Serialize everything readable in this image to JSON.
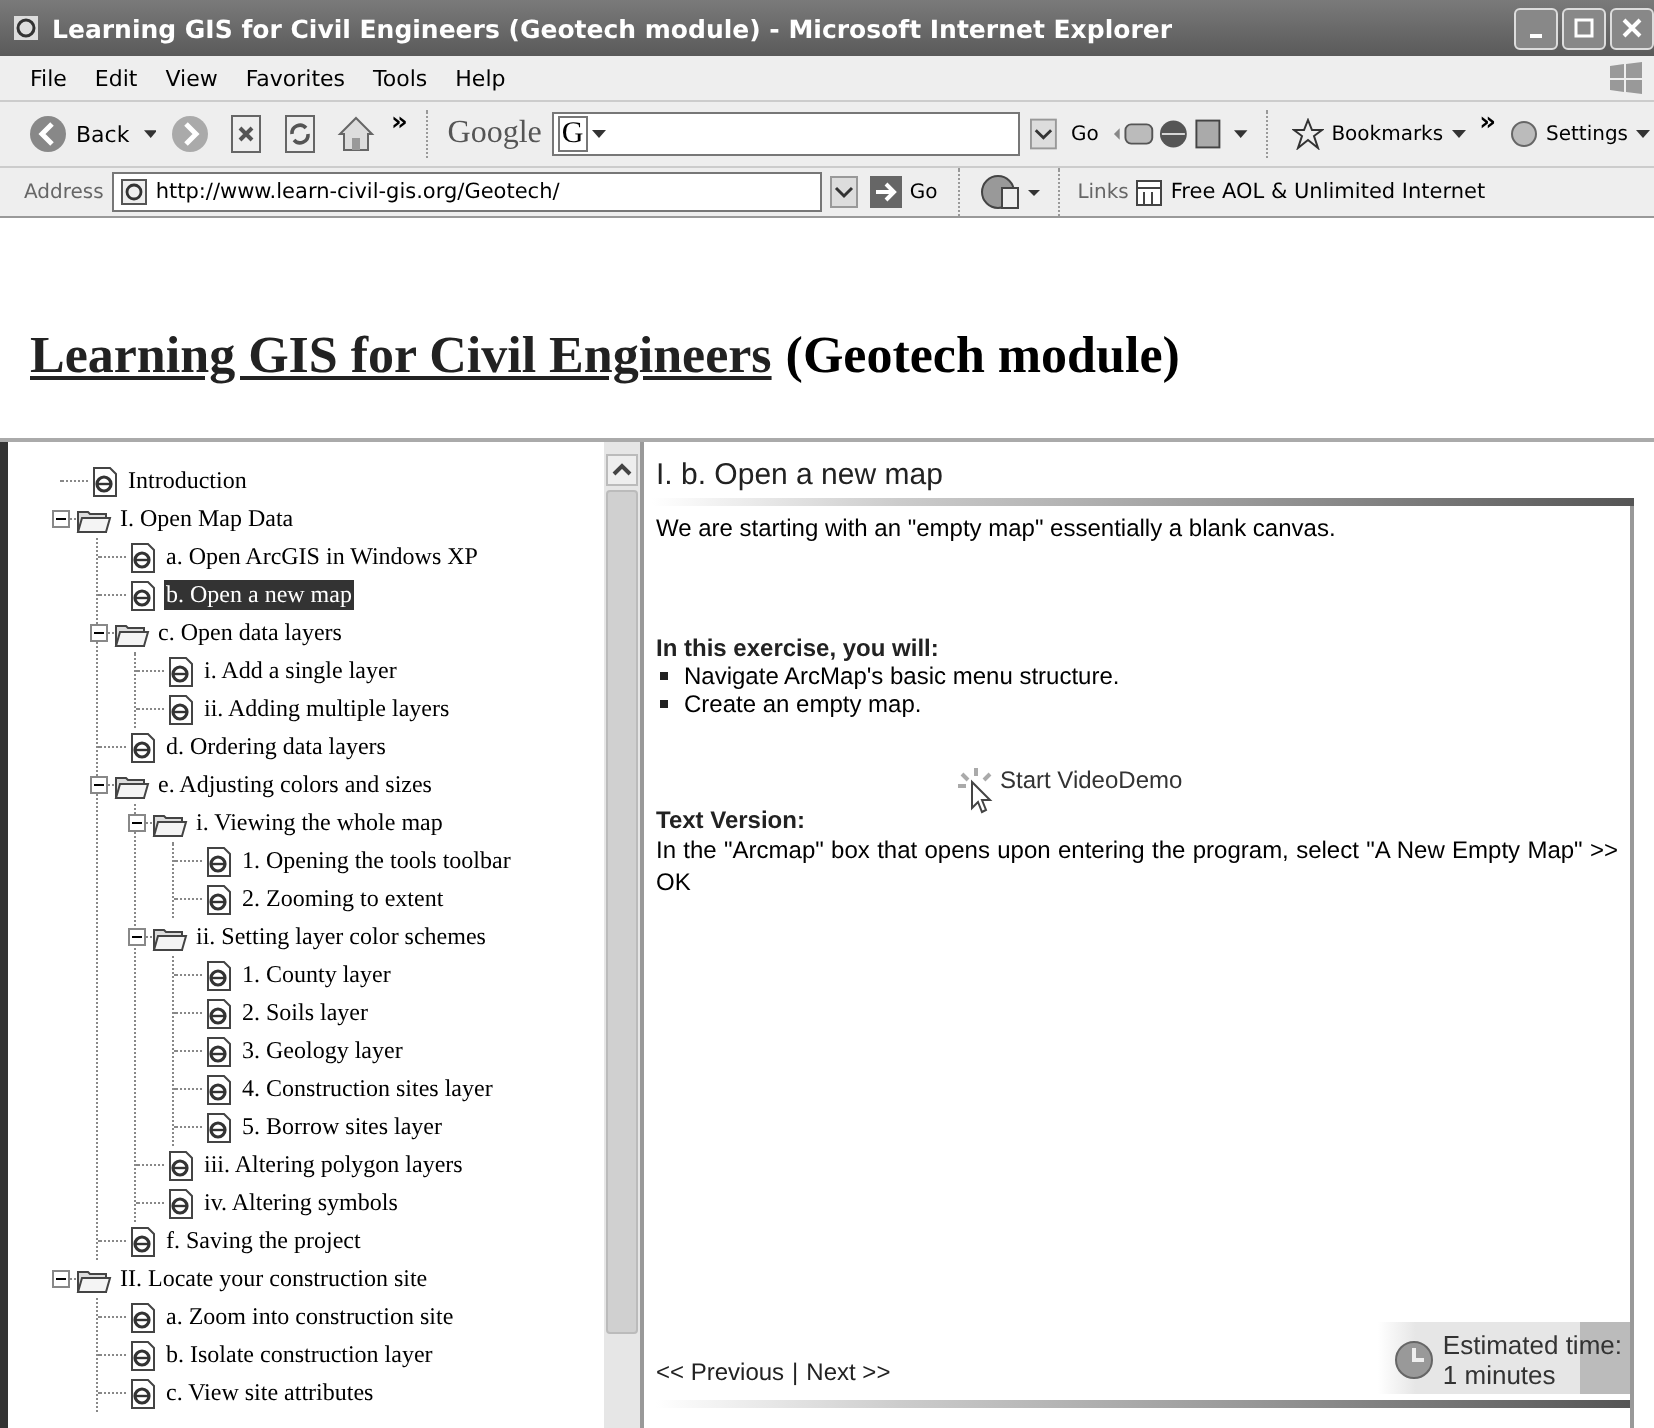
{
  "window": {
    "title": "Learning GIS for Civil Engineers (Geotech module) - Microsoft Internet Explorer"
  },
  "menu": [
    "File",
    "Edit",
    "View",
    "Favorites",
    "Tools",
    "Help"
  ],
  "toolbar": {
    "back": "Back",
    "chevron": "»",
    "search_logo": "Google",
    "search_button": "G",
    "go": "Go",
    "bookmarks": "Bookmarks",
    "chevron_2": "»",
    "settings": "Settings"
  },
  "address_bar": {
    "label": "Address",
    "url": "http://www.learn-civil-gis.org/Geotech/",
    "go": "Go",
    "links_label": "Links",
    "link": "Free AOL & Unlimited Internet"
  },
  "page": {
    "title_link": "Learning GIS for Civil Engineers",
    "title_rest": "(Geotech module)"
  },
  "tree": [
    {
      "label": "Introduction",
      "kind": "page",
      "selected": false
    },
    {
      "label": "I. Open Map Data",
      "kind": "folder",
      "expanded": true,
      "selected": false,
      "children": [
        {
          "label": "a. Open ArcGIS in Windows XP",
          "kind": "page",
          "selected": false
        },
        {
          "label": "b. Open a new map",
          "kind": "page",
          "selected": true
        },
        {
          "label": "c. Open data layers",
          "kind": "folder",
          "expanded": true,
          "selected": false,
          "children": [
            {
              "label": "i. Add a single layer",
              "kind": "page",
              "selected": false
            },
            {
              "label": "ii. Adding multiple layers",
              "kind": "page",
              "selected": false
            }
          ]
        },
        {
          "label": "d. Ordering data layers",
          "kind": "page",
          "selected": false
        },
        {
          "label": "e. Adjusting colors and sizes",
          "kind": "folder",
          "expanded": true,
          "selected": false,
          "children": [
            {
              "label": "i. Viewing the whole map",
              "kind": "folder",
              "expanded": true,
              "selected": false,
              "children": [
                {
                  "label": "1. Opening the tools toolbar",
                  "kind": "page",
                  "selected": false
                },
                {
                  "label": "2. Zooming to extent",
                  "kind": "page",
                  "selected": false
                }
              ]
            },
            {
              "label": "ii. Setting layer color schemes",
              "kind": "folder",
              "expanded": true,
              "selected": false,
              "children": [
                {
                  "label": "1. County layer",
                  "kind": "page",
                  "selected": false
                },
                {
                  "label": "2. Soils layer",
                  "kind": "page",
                  "selected": false
                },
                {
                  "label": "3. Geology layer",
                  "kind": "page",
                  "selected": false
                },
                {
                  "label": "4. Construction sites layer",
                  "kind": "page",
                  "selected": false
                },
                {
                  "label": "5. Borrow sites layer",
                  "kind": "page",
                  "selected": false
                }
              ]
            },
            {
              "label": "iii. Altering polygon layers",
              "kind": "page",
              "selected": false
            },
            {
              "label": "iv. Altering symbols",
              "kind": "page",
              "selected": false
            }
          ]
        },
        {
          "label": "f. Saving the project",
          "kind": "page",
          "selected": false
        }
      ]
    },
    {
      "label": "II. Locate your construction site",
      "kind": "folder",
      "expanded": true,
      "selected": false,
      "children": [
        {
          "label": "a. Zoom into construction site",
          "kind": "page",
          "selected": false
        },
        {
          "label": "b. Isolate construction layer",
          "kind": "page",
          "selected": false
        },
        {
          "label": "c. View site attributes",
          "kind": "page",
          "selected": false
        }
      ]
    }
  ],
  "lesson": {
    "heading": "I. b. Open a new map",
    "intro": "We are starting with an \"empty map\" essentially a blank canvas.",
    "objectives_title": "In this exercise, you will:",
    "objectives": [
      "Navigate ArcMap's basic menu structure.",
      "Create an empty map."
    ],
    "video_link": "Start VideoDemo",
    "text_version_title": "Text Version:",
    "text_version": "In the \"Arcmap\" box that opens upon entering the program, select \"A New Empty Map\" >> OK",
    "nav": {
      "previous": "<< Previous",
      "separator": "|",
      "next": "Next >>"
    },
    "estimate": {
      "label": "Estimated time:",
      "value": "1 minutes"
    }
  }
}
